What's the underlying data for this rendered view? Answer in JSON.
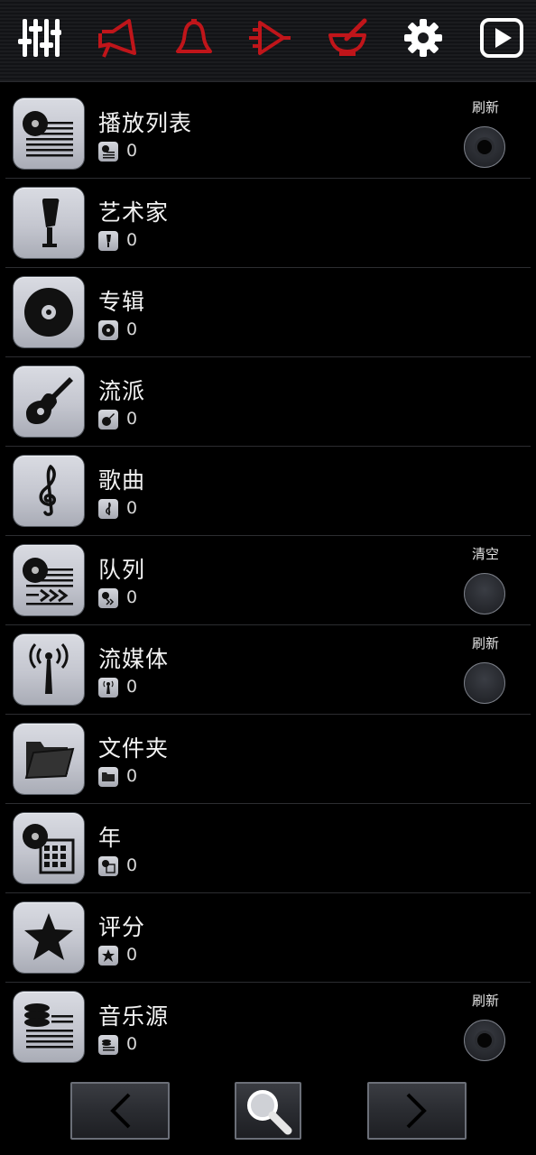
{
  "toolbar": {
    "icons": [
      "equalizer-icon",
      "speaker-icon",
      "bell-icon",
      "amplifier-icon",
      "mortar-icon",
      "gear-icon",
      "play-icon"
    ],
    "colors": {
      "white": "#ffffff",
      "red": "#c0151a"
    }
  },
  "list": [
    {
      "title": "播放列表",
      "count": "0",
      "icon": "playlist-icon",
      "action": "刷新",
      "action_state": "dot"
    },
    {
      "title": "艺术家",
      "count": "0",
      "icon": "microphone-icon"
    },
    {
      "title": "专辑",
      "count": "0",
      "icon": "disc-icon"
    },
    {
      "title": "流派",
      "count": "0",
      "icon": "guitar-icon"
    },
    {
      "title": "歌曲",
      "count": "0",
      "icon": "treble-clef-icon"
    },
    {
      "title": "队列",
      "count": "0",
      "icon": "queue-icon",
      "action": "清空",
      "action_state": "plain"
    },
    {
      "title": "流媒体",
      "count": "0",
      "icon": "antenna-icon",
      "action": "刷新",
      "action_state": "plain"
    },
    {
      "title": "文件夹",
      "count": "0",
      "icon": "folder-icon"
    },
    {
      "title": "年",
      "count": "0",
      "icon": "calendar-icon"
    },
    {
      "title": "评分",
      "count": "0",
      "icon": "star-icon"
    },
    {
      "title": "音乐源",
      "count": "0",
      "icon": "music-source-icon",
      "action": "刷新",
      "action_state": "dot"
    }
  ],
  "bottom_nav": [
    "back-icon",
    "search-icon",
    "forward-icon"
  ]
}
